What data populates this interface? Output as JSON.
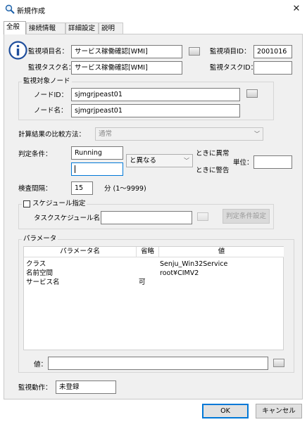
{
  "window": {
    "title": "新規作成",
    "icon": "magnifier-icon",
    "close_label": "✕"
  },
  "tabs": [
    {
      "label": "全般",
      "active": true
    },
    {
      "label": "接続情報",
      "active": false
    },
    {
      "label": "詳細設定",
      "active": false
    },
    {
      "label": "説明",
      "active": false
    }
  ],
  "general": {
    "item_name_label": "監視項目名：",
    "item_name_value": "サービス稼働確認[WMI]",
    "item_id_label": "監視項目ID：",
    "item_id_value": "2001016",
    "task_name_label": "監視タスク名：",
    "task_name_value": "サービス稼働確認[WMI]",
    "task_id_label": "監視タスクID：",
    "task_id_value": ""
  },
  "node": {
    "group_label": "監視対象ノード",
    "node_id_label": "ノードID：",
    "node_id_value": "sjmgrjpeast01",
    "node_name_label": "ノード名：",
    "node_name_value": "sjmgrjpeast01"
  },
  "compare": {
    "label": "計算結果の比較方法：",
    "value": "通常"
  },
  "condition": {
    "label": "判定条件：",
    "value1": "Running",
    "value2": "",
    "operator": "と異なる",
    "abnormal_label": "ときに異常",
    "warning_label": "ときに警告",
    "unit_label": "単位：",
    "unit_value": ""
  },
  "interval": {
    "label": "検査間隔：",
    "value": "15",
    "unit": "分 (1〜9999)"
  },
  "schedule": {
    "checkbox_label": "スケジュール指定",
    "checked": false,
    "name_label": "タスクスケジュール名：",
    "name_value": "",
    "condition_button": "判定条件設定"
  },
  "params": {
    "group_label": "パラメータ",
    "columns": [
      "パラメータ名",
      "省略",
      "値"
    ],
    "rows": [
      {
        "name": "クラス",
        "omit": "",
        "value": "Senju_Win32Service"
      },
      {
        "name": "名前空間",
        "omit": "",
        "value": "root¥CIMV2"
      },
      {
        "name": "サービス名",
        "omit": "可",
        "value": ""
      }
    ],
    "value_label": "値：",
    "value_input": ""
  },
  "action": {
    "label": "監視動作：",
    "value": "未登録"
  },
  "buttons": {
    "ok": "OK",
    "cancel": "キャンセル"
  },
  "colors": {
    "focus": "#0078d7",
    "panel": "#f0f0f0"
  }
}
